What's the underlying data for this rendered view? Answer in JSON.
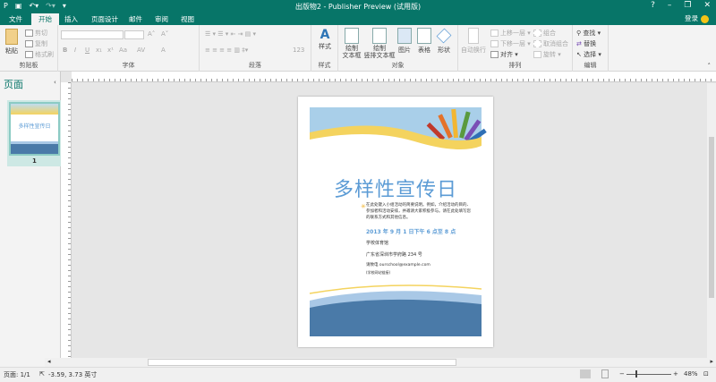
{
  "window": {
    "title": "出版物2 - Publisher Preview (试用版)",
    "help": "?",
    "minimize": "–",
    "restore": "❐",
    "close": "✕",
    "login": "登录"
  },
  "tabs": [
    {
      "label": "文件"
    },
    {
      "label": "开始"
    },
    {
      "label": "插入"
    },
    {
      "label": "页面设计"
    },
    {
      "label": "邮件"
    },
    {
      "label": "审阅"
    },
    {
      "label": "视图"
    }
  ],
  "ribbon": {
    "clipboard": {
      "paste": "粘贴",
      "cut": "剪切",
      "copy": "复制",
      "format_painter": "格式刷",
      "label": "剪贴板"
    },
    "font": {
      "bold": "B",
      "italic": "I",
      "underline": "U",
      "sub": "x₁",
      "sup": "x¹",
      "case": "Aa",
      "spacing": "AV",
      "color": "A",
      "grow": "A˄",
      "shrink": "A˅",
      "label": "字体"
    },
    "paragraph": {
      "label": "段落",
      "num": "123"
    },
    "styles": {
      "button": "样式",
      "label": "样式"
    },
    "objects": {
      "textbox": "绘制\n文本框",
      "vtextbox": "绘制\n竖排文本框",
      "picture": "图片",
      "table": "表格",
      "shape": "形状",
      "label": "对象"
    },
    "arrange": {
      "wrap": "自动换行",
      "forward": "上移一层",
      "backward": "下移一层",
      "align": "对齐",
      "group": "组合",
      "ungroup": "取消组合",
      "rotate": "旋转",
      "label": "排列"
    },
    "editing": {
      "find": "查找",
      "replace": "替换",
      "select": "选择",
      "label": "编辑"
    }
  },
  "pages_pane": {
    "title": "页面",
    "thumb_number": "1",
    "thumb_title": "多样性宣传日"
  },
  "document": {
    "title": "多样性宣传日",
    "description": "在此处键入小组活动的简要说明。例如，介绍活动的目的、参加者和活动安排，并邀请大家积极参与。请在此处填写您的联系方式和其他信息。",
    "date": "2013 年 9 月 1 日下午 6 点至 8 点",
    "venue": "学校体育馆",
    "address": "广东省深圳市学府路 234 号",
    "contact": "请致电 ourschool@example.com",
    "website": "(学校网站链接)"
  },
  "status": {
    "page": "页面: 1/1",
    "position": "-3.59, 3.73 英寸",
    "zoom": "48%"
  },
  "colors": {
    "accent": "#077568",
    "title_blue": "#5b9bd5",
    "wave_yellow": "#f4d35e",
    "wave_blue": "#4a7aa8"
  }
}
